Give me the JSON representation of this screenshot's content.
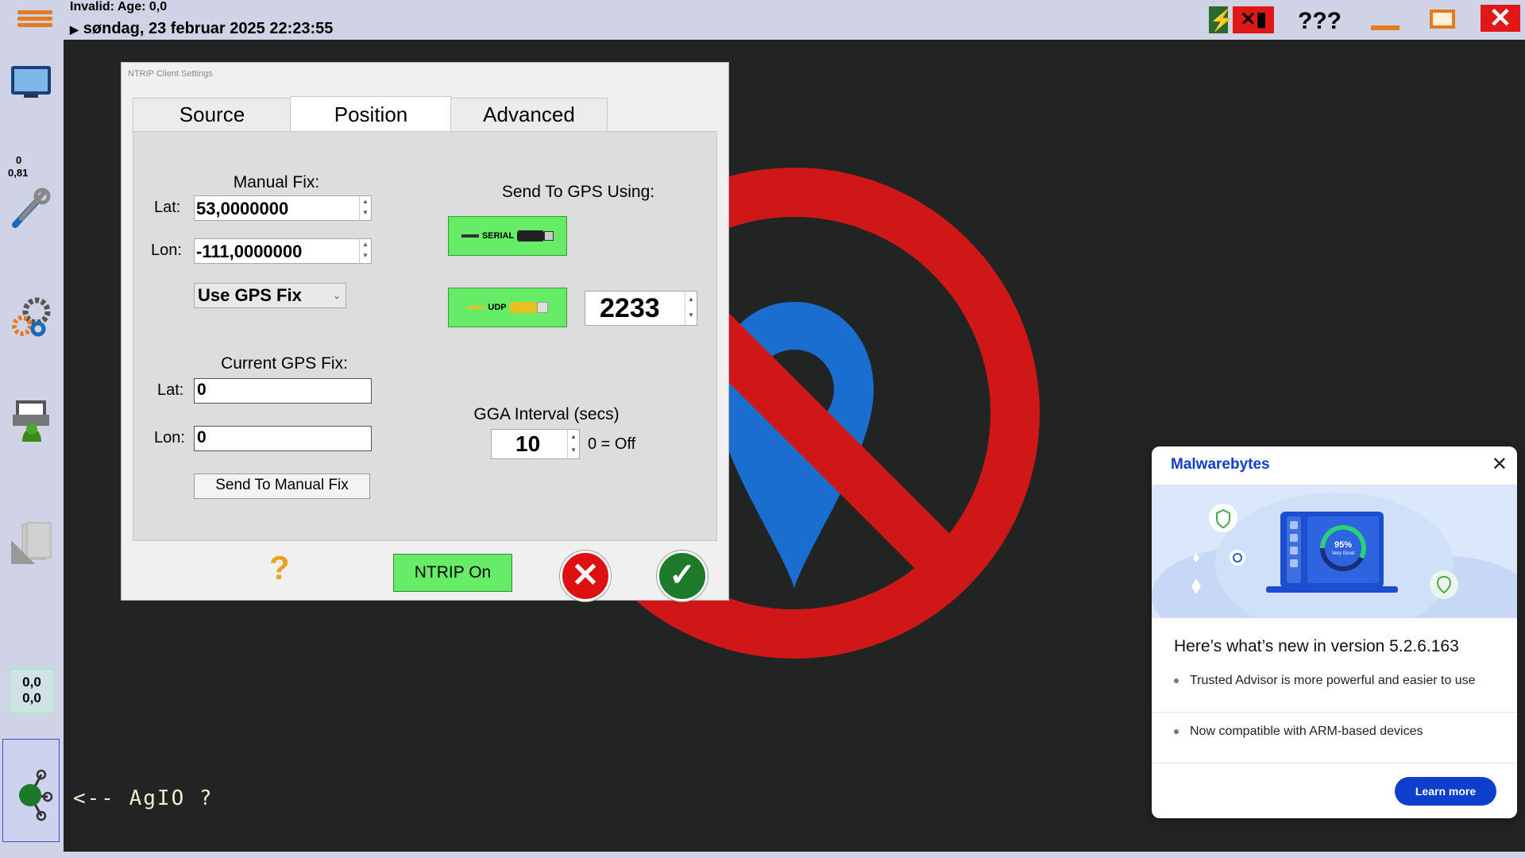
{
  "status": {
    "line1": "Invalid: Age: 0,0",
    "datetime": "søndag, 23 februar 2025 22:23:55",
    "unknown_indicator": "???"
  },
  "sidebar": {
    "speed_top": "0",
    "speed_bottom": "0,81",
    "coord_top": "0,0",
    "coord_bottom": "0,0"
  },
  "footer": {
    "agio_label": "<-- AgIO  ?"
  },
  "dialog": {
    "title": "NTRIP Client Settings",
    "tabs": [
      {
        "label": "Source"
      },
      {
        "label": "Position"
      },
      {
        "label": "Advanced"
      }
    ],
    "manual_fix": {
      "heading": "Manual Fix:",
      "lat_label": "Lat:",
      "lat_value": "53,0000000",
      "lon_label": "Lon:",
      "lon_value": "-111,0000000",
      "mode_selected": "Use GPS Fix"
    },
    "current_fix": {
      "heading": "Current GPS Fix:",
      "lat_label": "Lat:",
      "lat_value": "0",
      "lon_label": "Lon:",
      "lon_value": "0",
      "send_button": "Send To Manual Fix"
    },
    "send_to_gps": {
      "heading": "Send To GPS Using:",
      "serial_label": "SERIAL",
      "udp_label": "UDP",
      "udp_port": "2233"
    },
    "gga": {
      "label": "GGA Interval (secs)",
      "value": "10",
      "hint": "0 = Off"
    },
    "buttons": {
      "help": "?",
      "ntrip": "NTRIP On"
    }
  },
  "malwarebytes": {
    "brand": "Malwarebytes",
    "gauge_value": "95%",
    "gauge_caption": "Very Good",
    "title": "Here’s what’s new in version 5.2.6.163",
    "items": [
      "Trusted Advisor is more powerful and easier to use",
      "Now compatible with ARM-based devices"
    ],
    "learn_more": "Learn more"
  },
  "colors": {
    "accent_orange": "#e87a1e",
    "green_button": "#66ec66",
    "malwarebytes_blue": "#0d3ecc",
    "background_dark": "#222424"
  }
}
